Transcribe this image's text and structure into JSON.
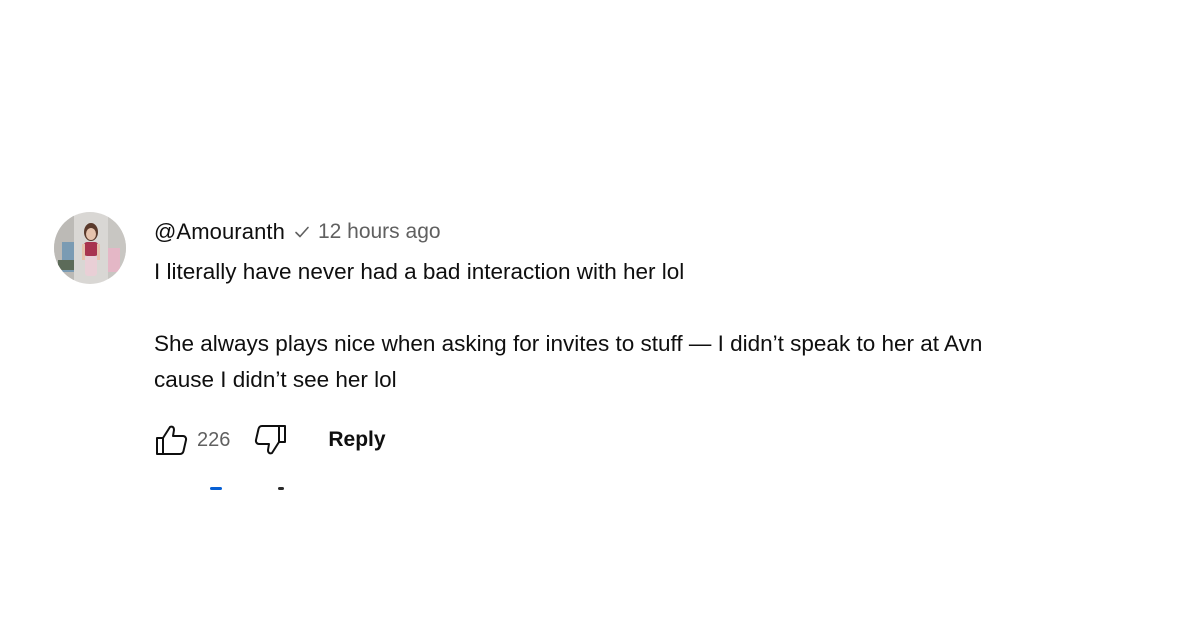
{
  "comment": {
    "author": "@Amouranth",
    "timestamp": "12 hours ago",
    "paragraphs": [
      "I literally have never had a bad interaction with her lol",
      "She always plays nice when asking for invites to stuff — I didn’t speak to her at Avn",
      "cause I didn’t see her lol"
    ],
    "like_count": "226",
    "reply_label": "Reply",
    "icons": {
      "verified": "checkmark-icon",
      "like": "thumbs-up-icon",
      "dislike": "thumbs-down-icon"
    }
  }
}
